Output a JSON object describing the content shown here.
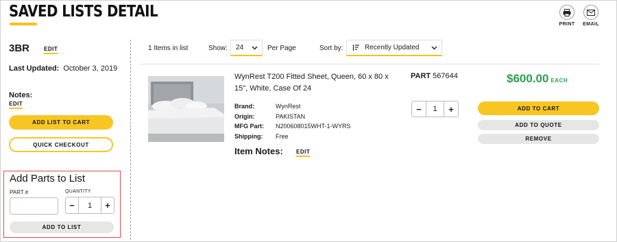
{
  "header": {
    "title": "SAVED LISTS DETAIL",
    "print_label": "PRINT",
    "email_label": "EMAIL",
    "accent_color": "#f5c11c"
  },
  "list": {
    "name": "3BR",
    "edit_label": "EDIT",
    "last_updated_label": "Last Updated:",
    "last_updated_value": "October 3, 2019",
    "notes_label": "Notes:",
    "notes_edit_label": "EDIT",
    "add_list_to_cart_label": "ADD LIST TO CART",
    "quick_checkout_label": "QUICK CHECKOUT"
  },
  "add_parts": {
    "title": "Add Parts to List",
    "part_label": "PART #",
    "part_value": "",
    "quantity_label": "QUANTITY",
    "quantity_value": "1",
    "minus": "−",
    "plus": "+",
    "add_label": "ADD TO LIST"
  },
  "toolbar": {
    "items_count": "1 Items in list",
    "show_label": "Show:",
    "show_value": "24",
    "per_page_label": "Per Page",
    "sort_label": "Sort by:",
    "sort_value": "Recently Updated"
  },
  "item": {
    "title": "WynRest T200 Fitted Sheet, Queen, 60 x 80 x 15\", White, Case Of 24",
    "specs": [
      {
        "key": "Brand:",
        "value": "WynRest"
      },
      {
        "key": "Origin:",
        "value": "PAKISTAN"
      },
      {
        "key": "MFG Part:",
        "value": "N200608015WHT-1-WYRS"
      },
      {
        "key": "Shipping:",
        "value": "Free"
      }
    ],
    "notes_label": "Item Notes:",
    "notes_edit_label": "EDIT",
    "part_label": "PART",
    "part_number": "567644",
    "quantity": "1",
    "minus": "−",
    "plus": "+",
    "price": "$600.00",
    "price_unit": "EACH",
    "price_color": "#2aa14a",
    "add_to_cart_label": "ADD TO CART",
    "add_to_quote_label": "ADD TO QUOTE",
    "remove_label": "REMOVE"
  }
}
